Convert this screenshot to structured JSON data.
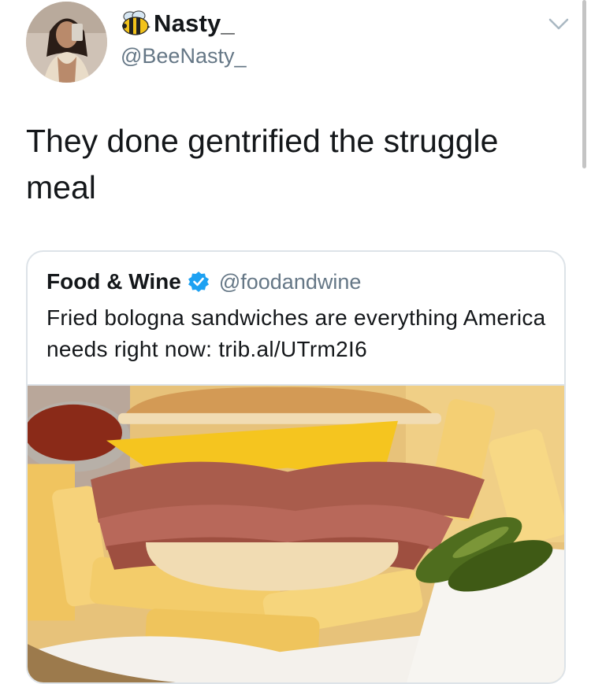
{
  "author": {
    "display_name": "Nasty_",
    "handle": "@BeeNasty_",
    "name_emoji": "bee-icon",
    "avatar": "avatar-photo"
  },
  "tweet": {
    "text": "They done gentrified the struggle meal"
  },
  "quoted_tweet": {
    "name": "Food & Wine",
    "verified": true,
    "handle": "@foodandwine",
    "text": "Fried bologna sandwiches are everything America needs right now: trib.al/UTrm2I6",
    "media": "fried-bologna-sandwich-photo"
  },
  "colors": {
    "text_primary": "#14171a",
    "text_secondary": "#657786",
    "verified_blue": "#1da1f2",
    "border": "#dde3e8"
  }
}
